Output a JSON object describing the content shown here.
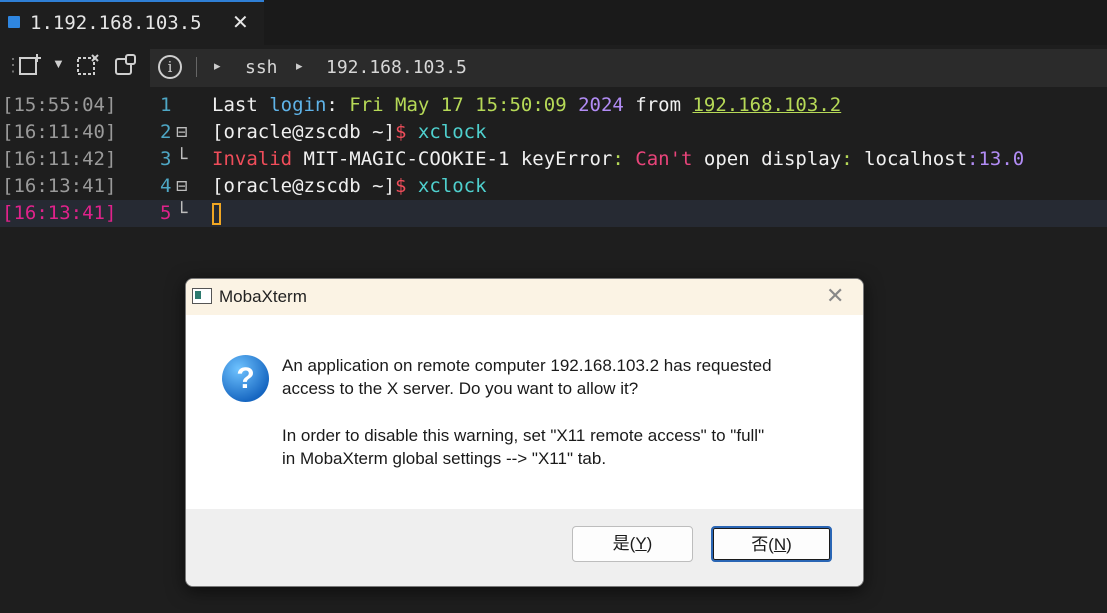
{
  "tab": {
    "title": "1.192.168.103.5",
    "close": "✕"
  },
  "address": {
    "arrow": "▸",
    "protocol": "ssh",
    "host": "192.168.103.5"
  },
  "terminal": {
    "lines": [
      {
        "timestamp": "[15:55:04]",
        "number": "1",
        "fold": "",
        "segments": [
          {
            "text": "Last ",
            "color": "white"
          },
          {
            "text": "login",
            "color": "blue"
          },
          {
            "text": ": ",
            "color": "white"
          },
          {
            "text": "Fri May 17 15:50:09 ",
            "color": "green"
          },
          {
            "text": "2024",
            "color": "purple"
          },
          {
            "text": " from ",
            "color": "white"
          },
          {
            "text": "192.168.103.2",
            "color": "green",
            "underline": true
          }
        ]
      },
      {
        "timestamp": "[16:11:40]",
        "number": "2",
        "fold": "⊟",
        "segments": [
          {
            "text": "[oracle@zscdb ~]",
            "color": "white"
          },
          {
            "text": "$ ",
            "color": "red"
          },
          {
            "text": "xclock",
            "color": "teal"
          }
        ]
      },
      {
        "timestamp": "[16:11:42]",
        "number": "3",
        "fold": "└",
        "segments": [
          {
            "text": "Invalid",
            "color": "red"
          },
          {
            "text": " MIT-MAGIC-COOKIE-1 keyError",
            "color": "white"
          },
          {
            "text": ": ",
            "color": "green"
          },
          {
            "text": "Can't",
            "color": "pink"
          },
          {
            "text": " open display",
            "color": "white"
          },
          {
            "text": ": ",
            "color": "green"
          },
          {
            "text": "localhost",
            "color": "white"
          },
          {
            "text": ":13.0",
            "color": "purple"
          }
        ]
      },
      {
        "timestamp": "[16:13:41]",
        "number": "4",
        "fold": "⊟",
        "segments": [
          {
            "text": "[oracle@zscdb ~]",
            "color": "white"
          },
          {
            "text": "$ ",
            "color": "red"
          },
          {
            "text": "xclock",
            "color": "teal"
          }
        ]
      },
      {
        "timestamp": "[16:13:41]",
        "number": "5",
        "fold": "└",
        "active": true,
        "segments": []
      }
    ]
  },
  "dialog": {
    "title": "MobaXterm",
    "close": "✕",
    "icon": "question-icon",
    "icon_glyph": "?",
    "message_line1": "An application on remote computer 192.168.103.2 has requested",
    "message_line2": "access to the X server. Do you want to allow it?",
    "message_line3": "In order to disable this warning, set \"X11 remote access\" to \"full\"",
    "message_line4": "in MobaXterm global settings --> \"X11\" tab.",
    "yes_prefix": "是(",
    "yes_key": "Y",
    "yes_suffix": ")",
    "no_prefix": "否(",
    "no_key": "N",
    "no_suffix": ")"
  },
  "colors": {
    "white": "#f0f0f0",
    "blue": "#5fb3e8",
    "green": "#b6d957",
    "purple": "#b28cf5",
    "red": "#ef4d5a",
    "teal": "#4fd0ce",
    "pink": "#e8447a",
    "accent": "#2f7fd6",
    "active_line": "#e0228b"
  }
}
